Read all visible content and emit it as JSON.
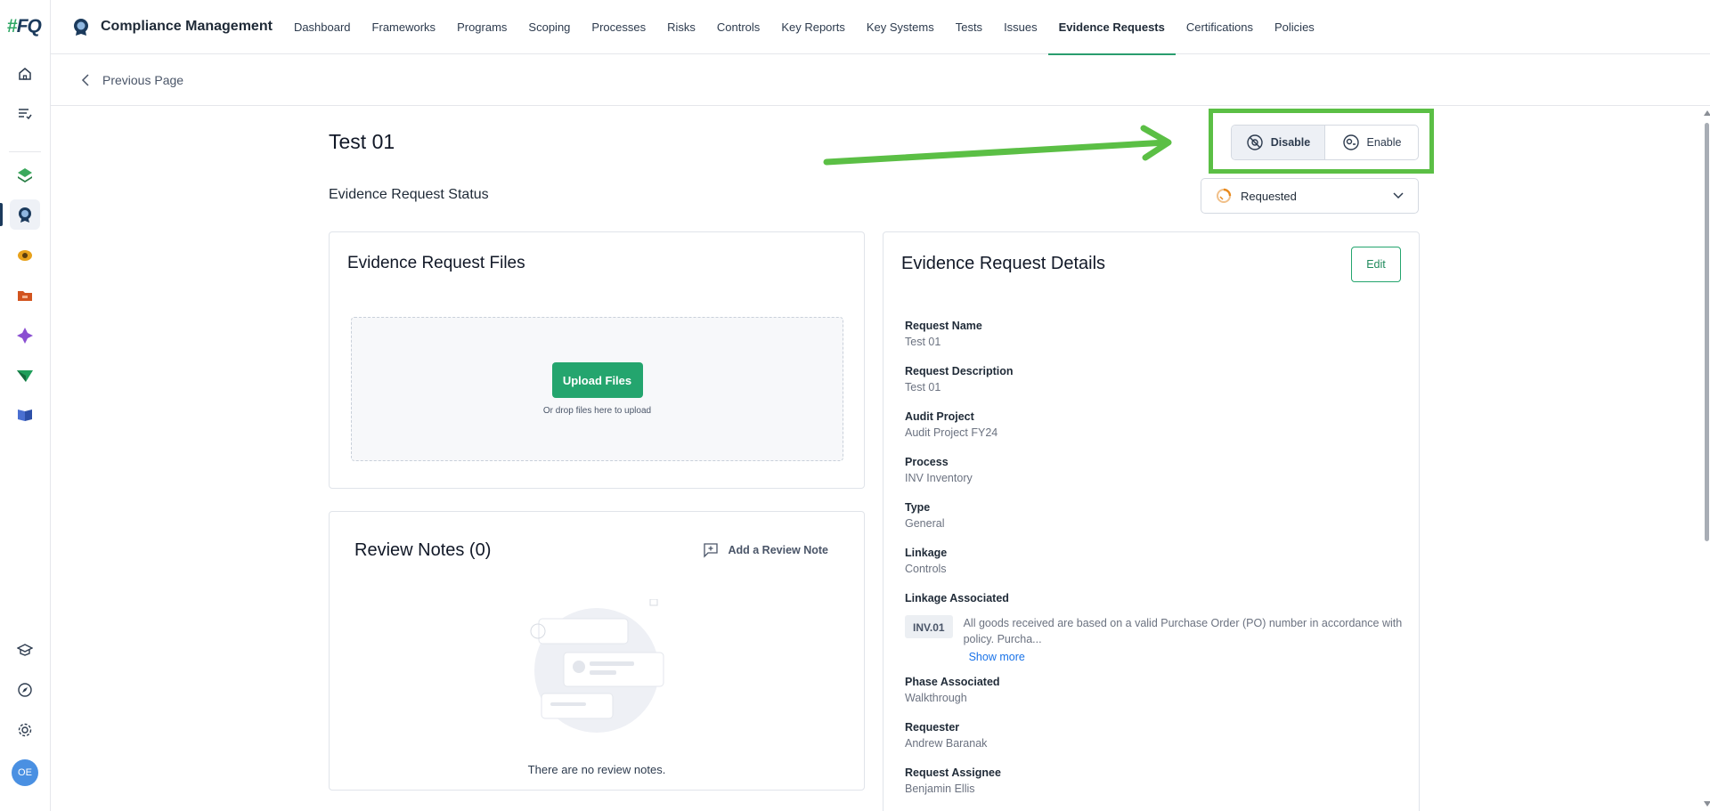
{
  "rail": {
    "logo_hash": "#",
    "logo_text": "FQ",
    "items": [
      {
        "name": "home-icon"
      },
      {
        "name": "tasks-icon"
      },
      {
        "name": "risk-app-icon"
      },
      {
        "name": "compliance-app-icon"
      },
      {
        "name": "audit-app-icon"
      },
      {
        "name": "files-app-icon"
      },
      {
        "name": "insights-app-icon"
      },
      {
        "name": "send-app-icon"
      },
      {
        "name": "library-app-icon"
      }
    ],
    "bottom": [
      {
        "name": "learning-icon"
      },
      {
        "name": "compass-icon"
      },
      {
        "name": "settings-icon"
      }
    ],
    "avatar_initials": "OE"
  },
  "header": {
    "app_title": "Compliance Management",
    "nav": [
      {
        "label": "Dashboard"
      },
      {
        "label": "Frameworks"
      },
      {
        "label": "Programs"
      },
      {
        "label": "Scoping"
      },
      {
        "label": "Processes"
      },
      {
        "label": "Risks"
      },
      {
        "label": "Controls"
      },
      {
        "label": "Key Reports"
      },
      {
        "label": "Key Systems"
      },
      {
        "label": "Tests"
      },
      {
        "label": "Issues"
      },
      {
        "label": "Evidence Requests",
        "active": true
      },
      {
        "label": "Certifications"
      },
      {
        "label": "Policies"
      }
    ]
  },
  "subbar": {
    "back_label": "Previous Page"
  },
  "page": {
    "title": "Test 01",
    "status_label": "Evidence Request Status",
    "toggle": {
      "disable": "Disable",
      "enable": "Enable",
      "selected": "Disable"
    },
    "status_value": "Requested"
  },
  "files": {
    "title": "Evidence Request Files",
    "upload_label": "Upload Files",
    "drop_hint": "Or drop files here to upload"
  },
  "notes": {
    "title": "Review Notes (0)",
    "add_label": "Add a Review Note",
    "empty_text": "There are no review notes."
  },
  "details": {
    "title": "Evidence Request Details",
    "edit_label": "Edit",
    "fields": [
      {
        "label": "Request Name",
        "value": "Test 01"
      },
      {
        "label": "Request Description",
        "value": "Test 01"
      },
      {
        "label": "Audit Project",
        "value": "Audit Project FY24"
      },
      {
        "label": "Process",
        "value": "INV Inventory"
      },
      {
        "label": "Type",
        "value": "General"
      },
      {
        "label": "Linkage",
        "value": "Controls"
      },
      {
        "label": "Linkage Associated",
        "value": ""
      },
      {
        "label": "Phase Associated",
        "value": "Walkthrough"
      },
      {
        "label": "Requester",
        "value": "Andrew Baranak"
      },
      {
        "label": "Request Assignee",
        "value": "Benjamin Ellis"
      }
    ],
    "linkage_chip": "INV.01",
    "linkage_text": "All goods received are based on a valid Purchase Order (PO) number in accordance with policy. Purcha...",
    "show_more": "Show more"
  },
  "colors": {
    "accent": "#24a56e",
    "highlight": "#5bbf45",
    "status_icon": "#e8891c"
  }
}
